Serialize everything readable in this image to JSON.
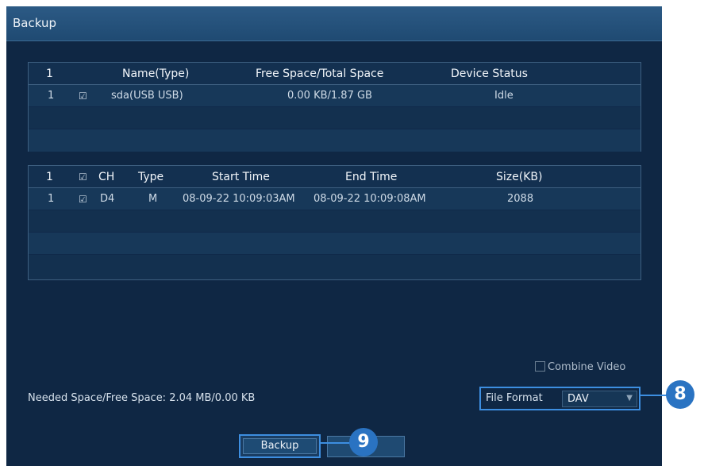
{
  "window": {
    "title": "Backup"
  },
  "devices": {
    "headers": [
      "1",
      "Name(Type)",
      "Free Space/Total Space",
      "Device Status"
    ],
    "rows": [
      {
        "num": "1",
        "name": "sda(USB USB)",
        "space": "0.00 KB/1.87 GB",
        "status": "Idle"
      }
    ]
  },
  "files": {
    "headers": [
      "1",
      "CH",
      "Type",
      "Start Time",
      "End Time",
      "Size(KB)"
    ],
    "rows": [
      {
        "num": "1",
        "ch": "D4",
        "type": "M",
        "start": "08-09-22 10:09:03AM",
        "end": "08-09-22 10:09:08AM",
        "size": "2088"
      }
    ]
  },
  "needed_space": "Needed Space/Free Space: 2.04 MB/0.00 KB",
  "combine_video": {
    "label": "Combine Video",
    "checked": false
  },
  "file_format": {
    "label": "File Format",
    "value": "DAV"
  },
  "buttons": {
    "backup": "Backup",
    "cancel": ""
  },
  "callouts": {
    "file_format": "8",
    "backup": "9"
  },
  "colors": {
    "accent": "#3d8ee0",
    "callout": "#2a73c2",
    "background": "#0f2744"
  }
}
